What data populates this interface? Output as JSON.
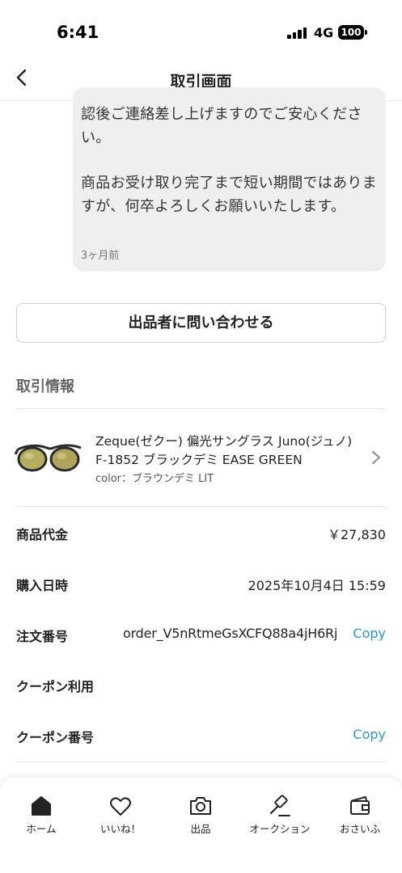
{
  "status_bar": {
    "time": "6:41",
    "network": "4G",
    "battery": "100"
  },
  "header": {
    "title": "取引画面"
  },
  "message": {
    "paragraphs": [
      "認後ご連絡差し上げますのでご安心ください。",
      "商品お受け取り完了まで短い期間ではありますが、何卒よろしくお願いいたします。"
    ],
    "time": "3ヶ月前"
  },
  "contact_button": "出品者に問い合わせる",
  "section_title": "取引情報",
  "product": {
    "name": "Zeque(ゼクー) 偏光サングラス Juno(ジュノ) F-1852 ブラックデミ EASE GREEN",
    "variant": "color：ブラウンデミ LIT"
  },
  "info": {
    "price_label": "商品代金",
    "price_value": "￥27,830",
    "date_label": "購入日時",
    "date_value": "2025年10月4日 15:59",
    "order_label": "注文番号",
    "order_value": "order_V5nRtmeGsXCFQ88a4jH6Rj",
    "coupon_use_label": "クーポン利用",
    "coupon_no_label": "クーポン番号",
    "copy_label": "Copy"
  },
  "tabbar": {
    "items": [
      {
        "label": "ホーム",
        "icon": "home-icon"
      },
      {
        "label": "いいね！",
        "icon": "heart-icon"
      },
      {
        "label": "出品",
        "icon": "camera-icon"
      },
      {
        "label": "オークション",
        "icon": "gavel-icon"
      },
      {
        "label": "おさいふ",
        "icon": "wallet-icon"
      }
    ]
  }
}
